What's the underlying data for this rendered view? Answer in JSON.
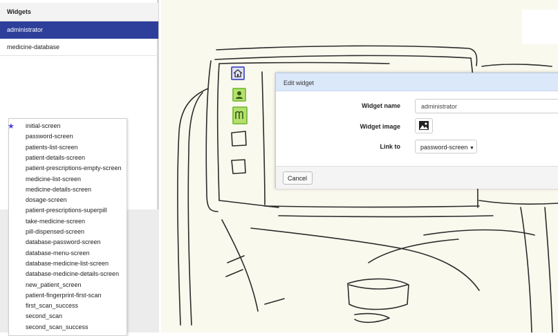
{
  "sidebar": {
    "header": "Widgets",
    "items": [
      {
        "label": "administrator"
      },
      {
        "label": "medicine-database"
      }
    ]
  },
  "screens": {
    "items": [
      {
        "label": "initial-screen"
      },
      {
        "label": "password-screen"
      },
      {
        "label": "patients-list-screen"
      },
      {
        "label": "patient-details-screen"
      },
      {
        "label": "patient-prescriptions-empty-screen"
      },
      {
        "label": "medicine-list-screen"
      },
      {
        "label": "medicine-details-screen"
      },
      {
        "label": "dosage-screen"
      },
      {
        "label": "patient-prescriptions-superpill"
      },
      {
        "label": "take-medicine-screen"
      },
      {
        "label": "pill-dispensed-screen"
      },
      {
        "label": "database-password-screen"
      },
      {
        "label": "database-menu-screen"
      },
      {
        "label": "database-medicine-list-screen"
      },
      {
        "label": "database-medicine-details-screen"
      },
      {
        "label": "new_patient_screen"
      },
      {
        "label": "patient-fingerprint-first-scan"
      },
      {
        "label": "first_scan_success"
      },
      {
        "label": "second_scan"
      },
      {
        "label": "second_scan_success"
      }
    ],
    "star_icon": "star-icon"
  },
  "modal": {
    "title": "Edit widget",
    "name_label": "Widget name",
    "name_value": "administrator",
    "image_label": "Widget image",
    "link_label": "Link to",
    "link_value": "password-screen",
    "cancel_label": "Cancel"
  },
  "colors": {
    "accent": "#2e3f9b",
    "canvas": "#faf9ee",
    "modal_header": "#dbe8f9",
    "icon_green": "#b7e06a",
    "icon_home": "#5a5fc8"
  }
}
